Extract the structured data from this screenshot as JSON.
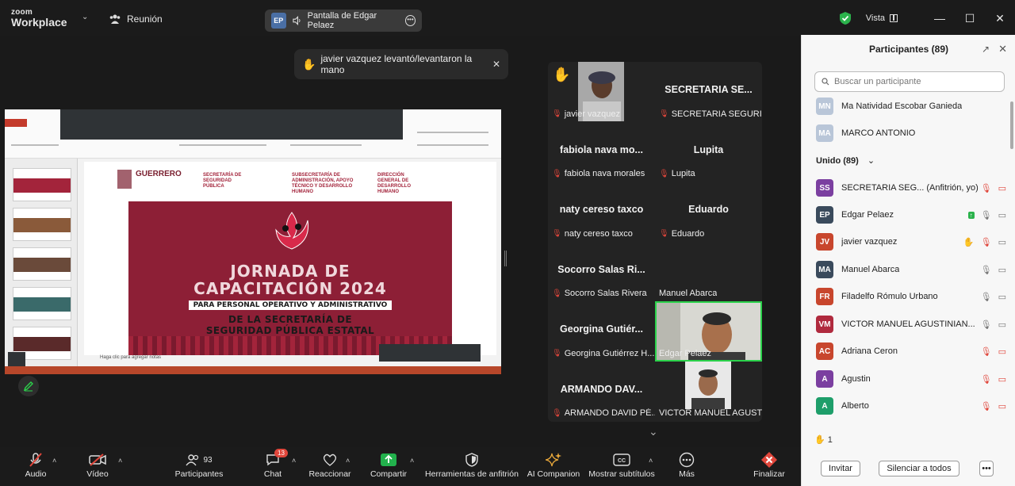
{
  "titlebar": {
    "brand_line1": "zoom",
    "brand_line2": "Workplace",
    "meeting_label": "Reunión",
    "share_initials": "EP",
    "share_label": "Pantalla de Edgar Pelaez",
    "view_label": "Vista",
    "shield_color": "#2bb24c"
  },
  "notification": {
    "text": "javier vazquez levantó/levantaron la mano"
  },
  "slide": {
    "state_label": "GUERRERO",
    "dept1": "SECRETARÍA DE SEGURIDAD PÚBLICA",
    "dept2": "SUBSECRETARÍA DE ADMINISTRACIÓN, APOYO TÉCNICO Y DESARROLLO HUMANO",
    "dept3": "DIRECCIÓN GENERAL DE DESARROLLO HUMANO",
    "title1": "JORNADA DE",
    "title2": "CAPACITACIÓN 2024",
    "subtitle": "PARA PERSONAL OPERATIVO Y ADMINISTRATIVO",
    "line4": "DE LA SECRETARÍA DE",
    "line5": "SEGURIDAD PÚBLICA ESTATAL",
    "notes": "Haga clic para agregar notas",
    "banner_color": "#8d1f36"
  },
  "gallery": {
    "tiles": [
      {
        "big": "",
        "label": "javier vazquez"
      },
      {
        "big": "SECRETARIA SE...",
        "label": "SECRETARIA SEGURID..."
      },
      {
        "big": "fabiola nava mo...",
        "label": "fabiola nava morales"
      },
      {
        "big": "Lupita",
        "label": "Lupita"
      },
      {
        "big": "naty cereso taxco",
        "label": "naty cereso taxco"
      },
      {
        "big": "Eduardo",
        "label": "Eduardo"
      },
      {
        "big": "Socorro Salas Ri...",
        "label": "Socorro Salas Rivera"
      },
      {
        "big": "",
        "label": "Manuel Abarca"
      },
      {
        "big": "Georgina Gutiér...",
        "label": "Georgina Gutiérrez H..."
      },
      {
        "big": "",
        "label": "Edgar Pelaez"
      },
      {
        "big": "ARMANDO DAV...",
        "label": "ARMANDO DAVID PÉ..."
      },
      {
        "big": "",
        "label": "VICTOR MANUEL AGUST..."
      }
    ]
  },
  "panel": {
    "title": "Participantes (89)",
    "search_placeholder": "Buscar un participante",
    "top_rows": [
      {
        "initials": "MN",
        "name": "Ma Natividad Escobar Ganieda",
        "color": "#b9c6d8"
      },
      {
        "initials": "MA",
        "name": "MARCO ANTONIO",
        "color": "#b9c6d8"
      }
    ],
    "group_label": "Unido (89)",
    "rows": [
      {
        "initials": "SS",
        "name": "SECRETARIA SEG...  (Anfitrión, yo)",
        "color": "#7b3fa0"
      },
      {
        "initials": "EP",
        "name": "Edgar Pelaez",
        "color": "#3a4a5c"
      },
      {
        "initials": "JV",
        "name": "javier vazquez",
        "color": "#c8462d"
      },
      {
        "initials": "MA",
        "name": "Manuel Abarca",
        "color": "#3a4a5c"
      },
      {
        "initials": "FR",
        "name": "Filadelfo Rómulo Urbano",
        "color": "#c8462d"
      },
      {
        "initials": "VM",
        "name": "VICTOR MANUEL AGUSTINIAN...",
        "color": "#b02a3e"
      },
      {
        "initials": "AC",
        "name": "Adriana Ceron",
        "color": "#c8462d"
      },
      {
        "initials": "A",
        "name": "Agustin",
        "color": "#7b3fa0"
      },
      {
        "initials": "A",
        "name": "Alberto",
        "color": "#1e9e6a"
      }
    ],
    "hands_count": "1",
    "invite_label": "Invitar",
    "mute_all_label": "Silenciar a todos"
  },
  "toolbar": {
    "audio": "Audio",
    "video": "Vídeo",
    "participants": "Participantes",
    "participants_count": "93",
    "chat": "Chat",
    "chat_badge": "13",
    "reactions": "Reaccionar",
    "share": "Compartir",
    "host_tools": "Herramientas de anfitrión",
    "ai": "AI Companion",
    "captions": "Mostrar subtítulos",
    "more": "Más",
    "end": "Finalizar",
    "share_color": "#22b14c",
    "end_color": "#e0463b"
  }
}
